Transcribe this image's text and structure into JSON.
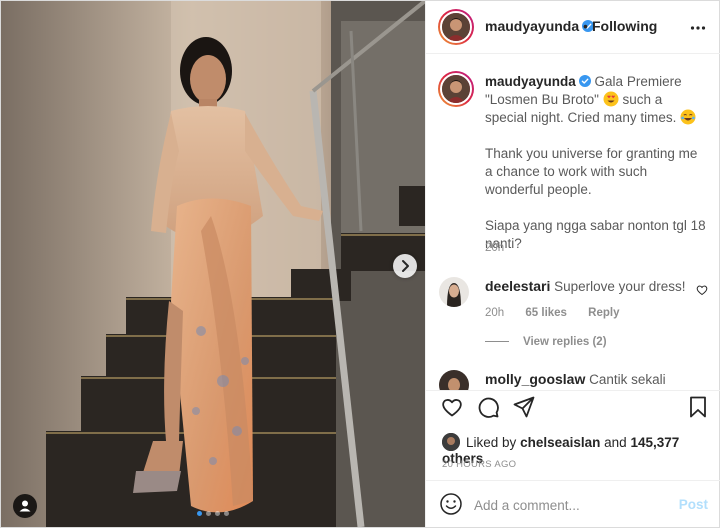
{
  "post": {
    "author": "maudyayunda",
    "follow_status": "Following",
    "separator": "•",
    "icons": {
      "verified": "verified-badge-icon",
      "more": "more-options-icon"
    }
  },
  "media": {
    "carousel": {
      "slide_count": 4,
      "active_index": 0
    },
    "icons": {
      "next": "chevron-right-icon",
      "tags": "user-tag-icon"
    }
  },
  "caption": {
    "username": "maudyayunda",
    "line1": "Gala Premiere \"Losmen Bu Broto\"",
    "line1_tail": "such a special night. Cried many times.",
    "emoji1": "heart-eyes-face",
    "emoji2": "tears-of-joy-face",
    "para2": "Thank you universe for granting me a chance to work with such wonderful people.",
    "para3": "Siapa yang ngga sabar nonton tgl 18 nanti?",
    "time": "20h"
  },
  "comments": [
    {
      "username": "deelestari",
      "text": "Superlove your dress!",
      "time": "20h",
      "likes": "65 likes",
      "reply": "Reply",
      "view_replies": "View replies (2)"
    },
    {
      "username": "molly_gooslaw",
      "text": "Cantik sekali"
    }
  ],
  "actions": {
    "like": "heart-icon",
    "comment": "comment-icon",
    "share": "share-icon",
    "save": "bookmark-icon"
  },
  "likes": {
    "prefix": "Liked by",
    "user": "chelseaislan",
    "conjunction": "and",
    "others": "145,377 others"
  },
  "timestamp": "20 HOURS AGO",
  "add_comment": {
    "placeholder": "Add a comment...",
    "post_label": "Post",
    "emoji_icon": "smiley-icon"
  },
  "colors": {
    "accent": "#3897f0",
    "post_disabled": "#b2dffc",
    "secondary_text": "#8e8e8e",
    "border": "#dbdbdb"
  }
}
